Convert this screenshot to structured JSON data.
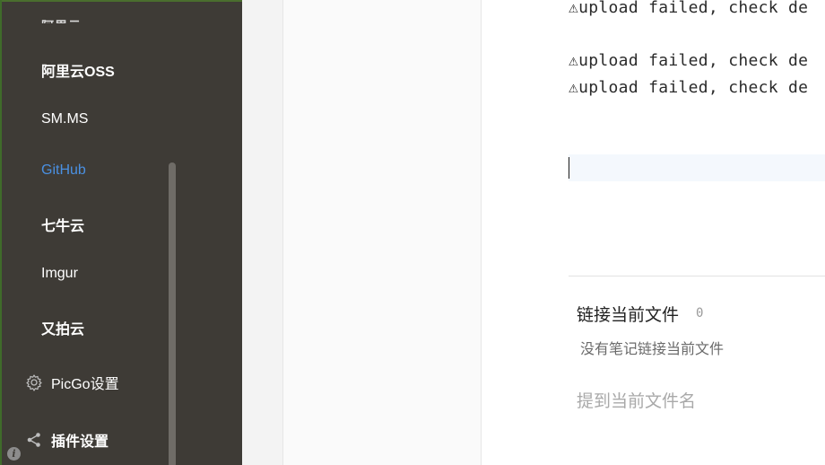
{
  "sidebar": {
    "partial_item_label": "阿里云",
    "items": [
      {
        "label": "阿里云OSS",
        "active": false
      },
      {
        "label": "SM.MS",
        "active": false
      },
      {
        "label": "GitHub",
        "active": true
      },
      {
        "label": "七牛云",
        "active": false
      },
      {
        "label": "Imgur",
        "active": false
      },
      {
        "label": "又拍云",
        "active": false
      }
    ],
    "sections": [
      {
        "label": "PicGo设置",
        "icon": "gear-icon"
      },
      {
        "label": "插件设置",
        "icon": "share-icon"
      }
    ],
    "info_icon_glyph": "i",
    "colors": {
      "background": "#3e3b36",
      "active": "#4a90e2",
      "text": "#ffffff"
    }
  },
  "editor": {
    "log_lines": [
      "⚠upload failed, check de",
      "⚠upload failed, check de",
      "⚠upload failed, check de"
    ],
    "backlinks": {
      "title": "链接当前文件",
      "count": "0",
      "empty_text": "没有笔记链接当前文件"
    },
    "mentions": {
      "title": "提到当前文件名"
    }
  }
}
